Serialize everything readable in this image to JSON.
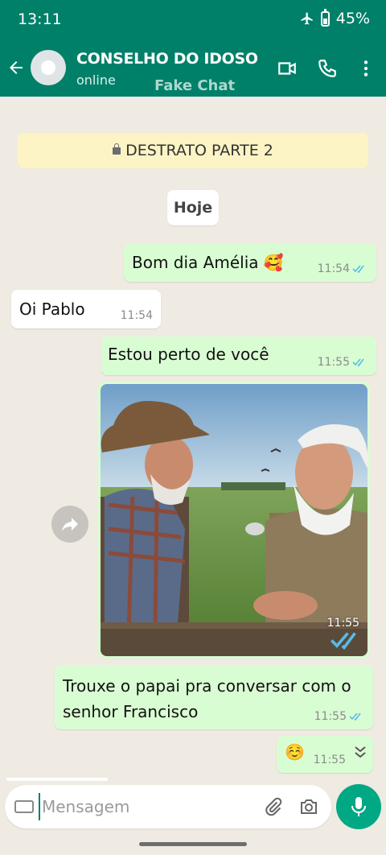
{
  "status_bar": {
    "time": "13:11",
    "battery": "45%",
    "icons": [
      "airplane-icon",
      "battery-icon"
    ]
  },
  "header": {
    "title": "CONSELHO DO IDOSO",
    "subtitle": "online",
    "watermark": "Fake Chat",
    "icons": [
      "back-arrow-icon",
      "video-call-icon",
      "voice-call-icon",
      "more-options-icon"
    ]
  },
  "chat": {
    "encryption_banner": "DESTRATO PARTE 2",
    "date_chip": "Hoje",
    "messages": [
      {
        "direction": "out",
        "text": "Bom dia Amélia 🥰",
        "time": "11:54",
        "read": true
      },
      {
        "direction": "in",
        "text": "Oi Pablo",
        "time": "11:54"
      },
      {
        "direction": "out",
        "text": "Estou perto  de você",
        "time": "11:55",
        "read": true
      },
      {
        "direction": "out",
        "type": "image",
        "image_name": "two-elderly-men-talking-photo",
        "time": "11:55",
        "read": true
      },
      {
        "direction": "out",
        "text": "Trouxe o papai pra conversar com o senhor Francisco",
        "time": "11:55",
        "read": true
      },
      {
        "direction": "out",
        "text": "☺️",
        "time": "11:55"
      }
    ]
  },
  "composer": {
    "placeholder": "Mensagem",
    "icons": [
      "keyboard-icon",
      "attach-icon",
      "camera-icon",
      "mic-icon"
    ]
  },
  "colors": {
    "header": "#008069",
    "accent": "#00a884",
    "outgoing": "#d9fdd3",
    "incoming": "#ffffff",
    "chat_bg": "#efeae2",
    "read_ticks": "#53bdeb"
  }
}
